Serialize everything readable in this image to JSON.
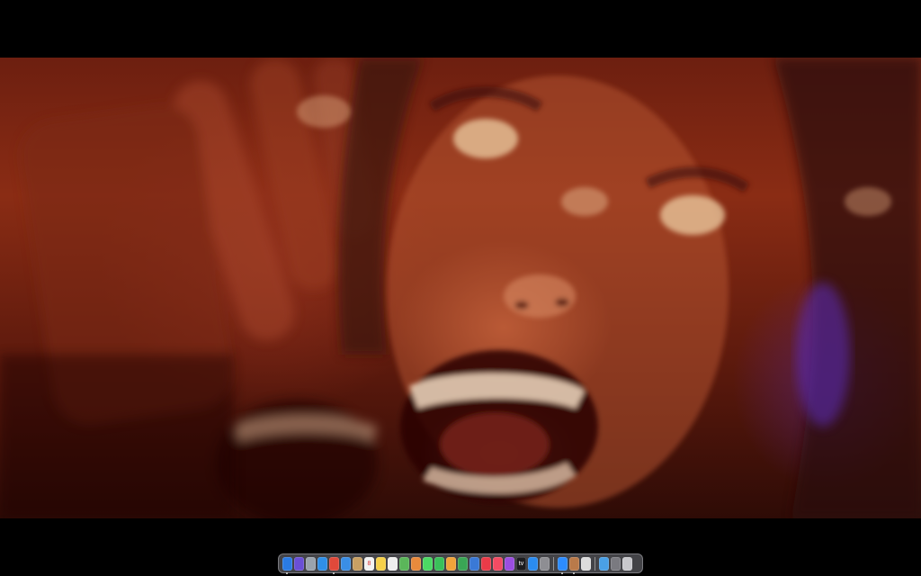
{
  "player": {
    "frame_description_icon": "video-frame"
  },
  "dock": {
    "apps": [
      {
        "icon": "finder-icon",
        "color": "#2a7be4",
        "running": true
      },
      {
        "icon": "siri-icon",
        "color": "#6a4fd6",
        "running": false
      },
      {
        "icon": "launchpad-icon",
        "color": "#9aa3ad",
        "running": false
      },
      {
        "icon": "safari-icon",
        "color": "#2f8fe8",
        "running": false
      },
      {
        "icon": "chrome-icon",
        "color": "#e0493a",
        "running": true
      },
      {
        "icon": "mail-icon",
        "color": "#3a8ee6",
        "running": false
      },
      {
        "icon": "contacts-icon",
        "color": "#c9a063",
        "running": false
      },
      {
        "icon": "calendar-icon",
        "color": "#f2f2f2",
        "label": "8",
        "running": false
      },
      {
        "icon": "notes-icon",
        "color": "#f5d04a",
        "running": false
      },
      {
        "icon": "reminders-icon",
        "color": "#eeeeee",
        "running": false
      },
      {
        "icon": "maps-icon",
        "color": "#5bb65a",
        "running": false
      },
      {
        "icon": "photos-icon",
        "color": "#e98a3c",
        "running": false
      },
      {
        "icon": "messages-icon",
        "color": "#4cd964",
        "running": false
      },
      {
        "icon": "facetime-icon",
        "color": "#3ac05a",
        "running": false
      },
      {
        "icon": "pages-icon",
        "color": "#f0a33a",
        "running": false
      },
      {
        "icon": "numbers-icon",
        "color": "#3aa655",
        "running": false
      },
      {
        "icon": "keynote-icon",
        "color": "#3a79d6",
        "running": false
      },
      {
        "icon": "news-icon",
        "color": "#ea3b48",
        "running": false
      },
      {
        "icon": "music-icon",
        "color": "#f24b63",
        "running": false
      },
      {
        "icon": "podcasts-icon",
        "color": "#9b4ee0",
        "running": false
      },
      {
        "icon": "tv-icon",
        "color": "#1c1c1e",
        "label": "tv",
        "running": false
      },
      {
        "icon": "app-store-icon",
        "color": "#2b8cf0",
        "running": false
      },
      {
        "icon": "system-preferences-icon",
        "color": "#8e8e93",
        "running": false
      }
    ],
    "apps_right": [
      {
        "icon": "zoom-icon",
        "color": "#2d8cff",
        "running": true
      },
      {
        "icon": "preview-icon",
        "color": "#b97a4a",
        "running": true
      },
      {
        "icon": "textedit-icon",
        "color": "#dcdcdc",
        "running": false
      }
    ],
    "stacks": [
      {
        "icon": "downloads-folder-icon",
        "color": "#4aa0e6"
      },
      {
        "icon": "screenshot-stack-icon",
        "color": "#7a7a80"
      },
      {
        "icon": "trash-icon",
        "color": "#c8c8cc"
      }
    ]
  }
}
